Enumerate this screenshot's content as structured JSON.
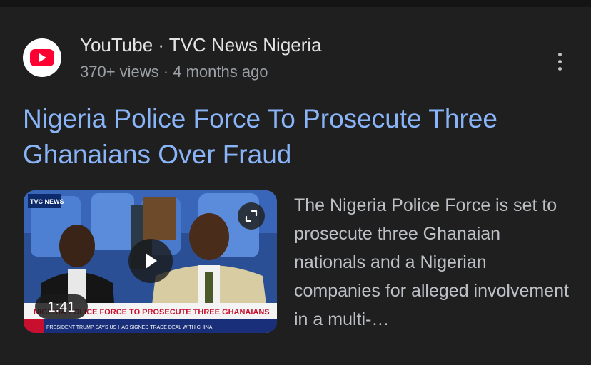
{
  "result": {
    "source": "YouTube · TVC News Nigeria",
    "meta": "370+ views · 4 months ago",
    "title": "Nigeria Police Force To Prosecute Three Ghanaians Over Fraud",
    "description": "The Nigeria Police Force is set to prosecute three Ghanaian nationals and a Nigerian companies for alleged involvement in a multi-…",
    "duration": "1:41",
    "thumbnail": {
      "channel_logo": "TVC NEWS",
      "lower_third": "NIGERIA POLICE FORCE TO PROSECUTE THREE GHANAIANS",
      "ticker": "PRESIDENT TRUMP SAYS US HAS SIGNED TRADE DEAL WITH CHINA"
    }
  },
  "icons": {
    "favicon": "youtube-logo-icon",
    "more": "more-vert-icon",
    "play": "play-icon",
    "expand": "expand-icon"
  },
  "colors": {
    "background": "#1f1f1f",
    "title_link": "#8ab4f8",
    "youtube_red": "#ff0033"
  }
}
